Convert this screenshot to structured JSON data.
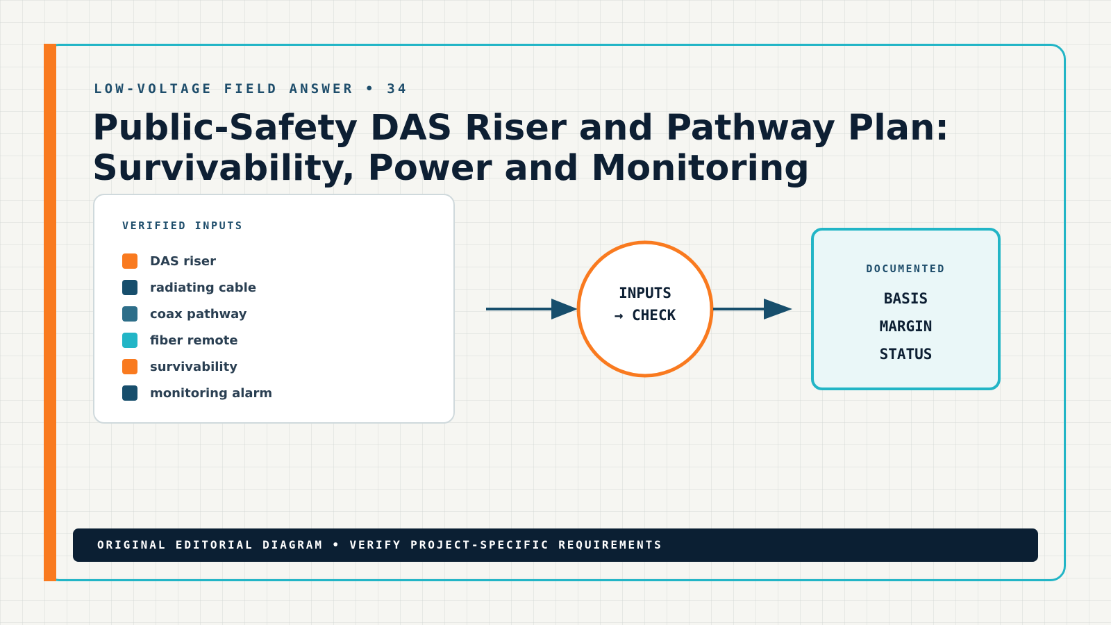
{
  "eyebrow": "LOW-VOLTAGE FIELD ANSWER • 34",
  "title": {
    "line1": "Public-Safety DAS Riser and Pathway Plan:",
    "line2": "Survivability, Power and Monitoring"
  },
  "inputs": {
    "label": "VERIFIED INPUTS",
    "items": [
      {
        "label": "DAS riser",
        "color": "#f97a1f"
      },
      {
        "label": "radiating cable",
        "color": "#174e6c"
      },
      {
        "label": "coax pathway",
        "color": "#2d6e89"
      },
      {
        "label": "fiber remote",
        "color": "#22b5c6"
      },
      {
        "label": "survivability",
        "color": "#f97a1f"
      },
      {
        "label": "monitoring alarm",
        "color": "#174e6c"
      }
    ]
  },
  "process": {
    "line1": "INPUTS",
    "line2": "→ CHECK"
  },
  "output": {
    "label": "DOCUMENTED",
    "items": [
      "BASIS",
      "MARGIN",
      "STATUS"
    ]
  },
  "footer": "ORIGINAL EDITORIAL DIAGRAM • VERIFY PROJECT-SPECIFIC REQUIREMENTS",
  "colors": {
    "accent": "#f97a1f",
    "frame": "#22b5c6",
    "arrow": "#174e6c",
    "ink": "#0d1f33"
  },
  "icons": [
    "arrow-right-icon"
  ]
}
